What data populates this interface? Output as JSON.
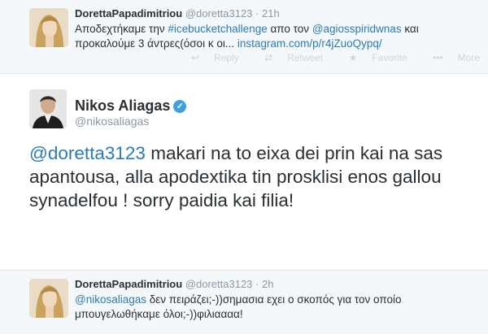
{
  "tweets": [
    {
      "display_name": "DorettaPapadimitriou",
      "handle": "@doretta3123",
      "separator": "·",
      "time": "21h",
      "text_part1": "Αποδεχτήκαμε την ",
      "hashtag": "#icebucketchallenge",
      "text_part2": " απο τον ",
      "mention": "@agiosspiridwnas",
      "text_part3": " και",
      "text_line2": "προκαλούμε 3 άντρες(όσοι κ οι... ",
      "link": "instagram.com/p/r4jZuoQypq/",
      "actions": {
        "reply": "Reply",
        "retweet": "Retweet",
        "favorite": "Favorite",
        "more": "More"
      }
    },
    {
      "display_name": "Nikos Aliagas",
      "handle": "@nikosaliagas",
      "mention": "@doretta3123",
      "text": " makari na to eixa dei prin kai na sas apantousa, alla apodextika tin prosklisi enos gallou synadelfou ! sorry paidia kai filia!"
    },
    {
      "display_name": "DorettaPapadimitriou",
      "handle": "@doretta3123",
      "separator": "·",
      "time": "2h",
      "mention": "@nikosaliagas",
      "text_line1": " δεν πειράζει;-))σημασια εχει ο σκοπός για τον οποίο",
      "text_line2": "μπουγελωθήκαμε όλοι;-))φιλιαααα!"
    }
  ],
  "colors": {
    "link": "#2b7bb9",
    "verified": "#3ea0e4",
    "muted": "#8899a6"
  }
}
